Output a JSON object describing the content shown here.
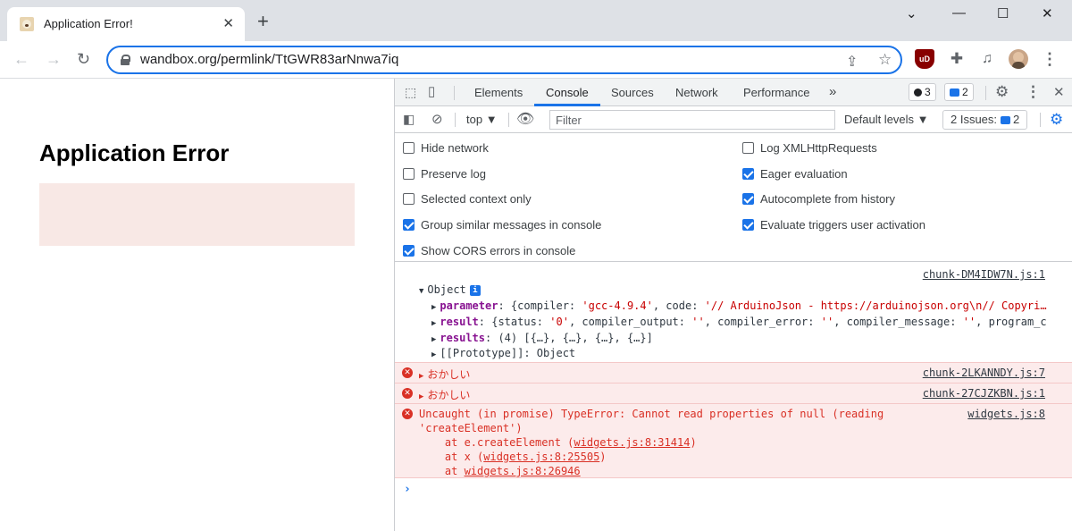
{
  "browser": {
    "tab_title": "Application Error!",
    "tab_close": "✕",
    "new_tab": "+",
    "url_host": "wandbox.org",
    "url_path": "/permlink/TtGWR83arNnwa7iq",
    "ublock_label": "uD",
    "win_min": "⌄",
    "win_minimize": "—",
    "win_max": "☐",
    "win_close": "✕"
  },
  "page": {
    "heading": "Application Error"
  },
  "devtools": {
    "tabs": [
      "Elements",
      "Console",
      "Sources",
      "Network",
      "Performance"
    ],
    "more_tabs": "»",
    "errors_count": "3",
    "messages_count": "2",
    "context": "top",
    "filter_placeholder": "Filter",
    "levels": "Default levels ▼",
    "issues_label": "2 Issues:",
    "issues_count": "2",
    "settings_left": [
      {
        "label": "Hide network",
        "checked": false
      },
      {
        "label": "Preserve log",
        "checked": false
      },
      {
        "label": "Selected context only",
        "checked": false
      },
      {
        "label": "Group similar messages in console",
        "checked": true
      },
      {
        "label": "Show CORS errors in console",
        "checked": true
      }
    ],
    "settings_right": [
      {
        "label": "Log XMLHttpRequests",
        "checked": false
      },
      {
        "label": "Eager evaluation",
        "checked": true
      },
      {
        "label": "Autocomplete from history",
        "checked": true
      },
      {
        "label": "Evaluate triggers user activation",
        "checked": true
      }
    ]
  },
  "console": {
    "log1_source": "chunk-DM4IDW7N.js:1",
    "object_label": "Object",
    "info_glyph": "i",
    "param_key": "parameter",
    "param_pre": ": {compiler: ",
    "param_compiler": "'gcc-4.9.4'",
    "param_mid": ", code: ",
    "param_code": "'// ArduinoJson - https://arduinojson.org\\n// Copyri…",
    "result_key": "result",
    "result_pre": ": {status: ",
    "result_status": "'0'",
    "result_mid1": ", compiler_output: ",
    "result_empty1": "''",
    "result_mid2": ", compiler_error: ",
    "result_empty2": "''",
    "result_mid3": ", compiler_message: ",
    "result_empty3": "''",
    "result_tail": ", program_c",
    "results_key": "results",
    "results_val": ": (4) [{…}, {…}, {…}, {…}]",
    "proto": "[[Prototype]]: Object",
    "err1_text": "おかしい",
    "err1_source": "chunk-2LKANNDY.js:7",
    "err2_text": "おかしい",
    "err2_source": "chunk-27CJZKBN.js:1",
    "err3_line1": "Uncaught (in promise) TypeError: Cannot read properties of null (reading",
    "err3_line2": "'createElement')",
    "err3_at1_pre": "    at e.createElement (",
    "err3_at1_link": "widgets.js:8:31414",
    "err3_at1_post": ")",
    "err3_at2_pre": "    at x (",
    "err3_at2_link": "widgets.js:8:25505",
    "err3_at2_post": ")",
    "err3_at3_pre": "    at ",
    "err3_at3_link": "widgets.js:8:26946",
    "err3_source": "widgets.js:8",
    "prompt": "›"
  },
  "colors": {
    "accent": "#1a73e8",
    "error": "#d93025",
    "error_bg": "#fcebeb"
  }
}
